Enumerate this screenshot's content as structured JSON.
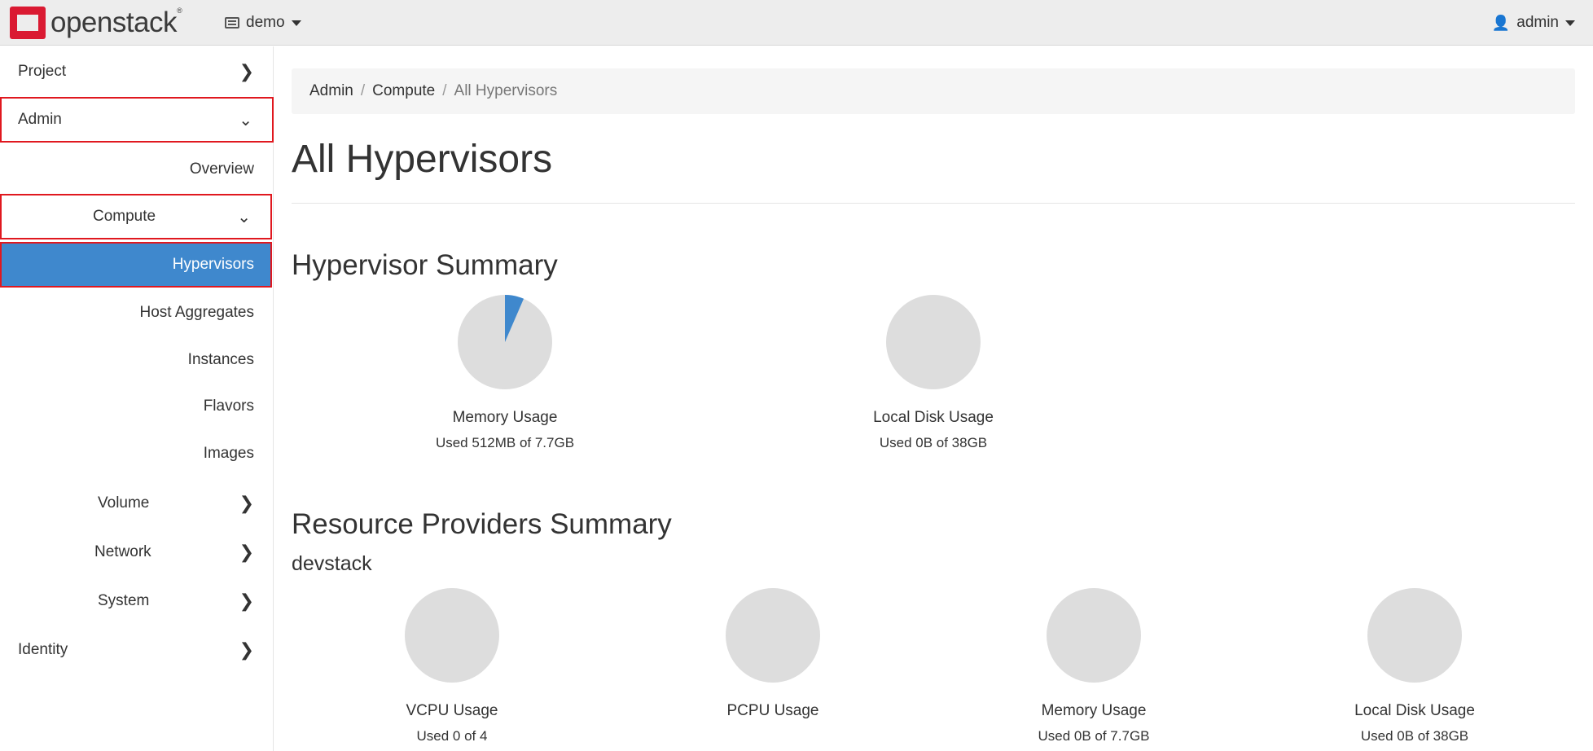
{
  "header": {
    "brand": "openstack",
    "brand_mark": "®",
    "project_menu": "demo",
    "user_menu": "admin"
  },
  "sidebar": {
    "project": "Project",
    "admin": "Admin",
    "overview": "Overview",
    "compute": "Compute",
    "hypervisors": "Hypervisors",
    "host_aggregates": "Host Aggregates",
    "instances": "Instances",
    "flavors": "Flavors",
    "images": "Images",
    "volume": "Volume",
    "network": "Network",
    "system": "System",
    "identity": "Identity"
  },
  "breadcrumb": [
    "Admin",
    "Compute",
    "All Hypervisors"
  ],
  "page_title": "All Hypervisors",
  "hypervisor_summary": {
    "title": "Hypervisor Summary",
    "charts": [
      {
        "title": "Memory Usage",
        "usage": "Used 512MB of 7.7GB",
        "fraction": 0.065
      },
      {
        "title": "Local Disk Usage",
        "usage": "Used 0B of 38GB",
        "fraction": 0
      }
    ]
  },
  "resource_providers": {
    "title": "Resource Providers Summary",
    "provider": "devstack",
    "charts": [
      {
        "title": "VCPU Usage",
        "usage": "Used 0 of 4",
        "fraction": 0
      },
      {
        "title": "PCPU Usage",
        "usage": "",
        "fraction": 0
      },
      {
        "title": "Memory Usage",
        "usage": "Used 0B of 7.7GB",
        "fraction": 0
      },
      {
        "title": "Local Disk Usage",
        "usage": "Used 0B of 38GB",
        "fraction": 0
      }
    ]
  },
  "colors": {
    "accent": "#3f88cd",
    "pie_empty": "#dddddd",
    "highlight": "#e0181f"
  }
}
